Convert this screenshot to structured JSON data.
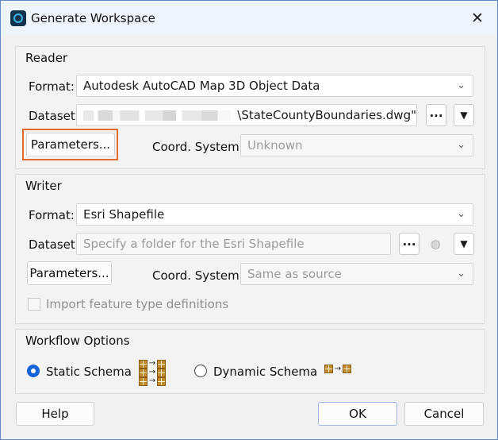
{
  "window": {
    "title": "Generate Workspace",
    "icons": {
      "app": "fme-app-icon",
      "close": "close-icon"
    }
  },
  "reader": {
    "heading": "Reader",
    "format_label": "Format:",
    "format_value": "Autodesk AutoCAD Map 3D Object Data",
    "dataset_label": "Dataset:",
    "dataset_value": "\\StateCountyBoundaries.dwg\"",
    "parameters_button": "Parameters...",
    "coord_label": "Coord. System:",
    "coord_value": "Unknown",
    "browse_button": "...",
    "dropdown_symbol": "▼"
  },
  "writer": {
    "heading": "Writer",
    "format_label": "Format:",
    "format_value": "Esri Shapefile",
    "dataset_label": "Dataset:",
    "dataset_placeholder": "Specify a folder for the Esri Shapefile",
    "parameters_button": "Parameters...",
    "coord_label": "Coord. System:",
    "coord_value": "Same as source",
    "browse_button": "...",
    "dropdown_symbol": "▼",
    "import_checkbox": "Import feature type definitions"
  },
  "workflow": {
    "heading": "Workflow Options",
    "static_option": "Static Schema",
    "dynamic_option": "Dynamic Schema",
    "selected": "Static Schema"
  },
  "buttons": {
    "help": "Help",
    "ok": "OK",
    "cancel": "Cancel"
  },
  "colors": {
    "accent": "#1563d8",
    "highlight_border": "#e36a2d",
    "schema_grid": "#c18a2a"
  }
}
